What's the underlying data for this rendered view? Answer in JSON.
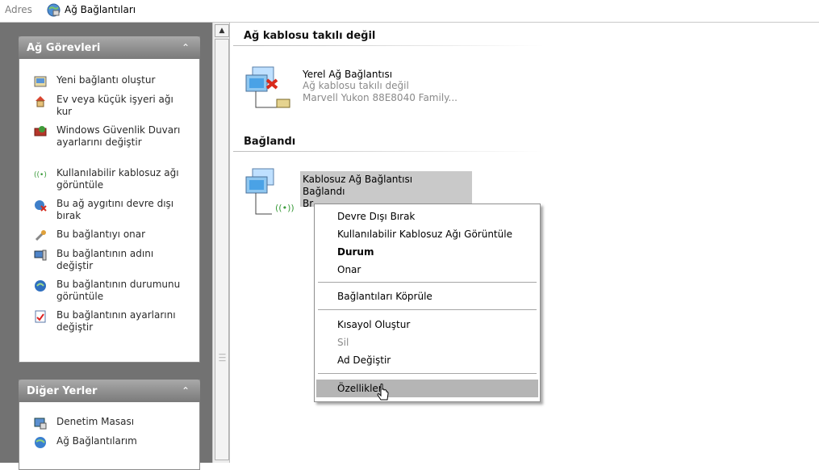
{
  "address": {
    "label": "Adres",
    "value": "Ağ Bağlantıları"
  },
  "tasks_panel": {
    "title": "Ağ Görevleri",
    "items": [
      {
        "icon": "new-connection-icon",
        "label": "Yeni bağlantı oluştur"
      },
      {
        "icon": "home-network-icon",
        "label": "Ev veya küçük işyeri ağı kur"
      },
      {
        "icon": "firewall-icon",
        "label": "Windows Güvenlik Duvarı ayarlarını değiştir"
      },
      {
        "icon": "wireless-icon",
        "label": "Kullanılabilir kablosuz ağı görüntüle"
      },
      {
        "icon": "disable-device-icon",
        "label": "Bu ağ aygıtını devre dışı bırak"
      },
      {
        "icon": "repair-icon",
        "label": "Bu bağlantıyı onar"
      },
      {
        "icon": "rename-icon",
        "label": "Bu bağlantının adını değiştir"
      },
      {
        "icon": "status-icon",
        "label": "Bu bağlantının durumunu görüntüle"
      },
      {
        "icon": "settings-icon",
        "label": "Bu bağlantının ayarlarını değiştir"
      }
    ]
  },
  "other_places_panel": {
    "title": "Diğer Yerler",
    "items": [
      {
        "icon": "control-panel-icon",
        "label": "Denetim Masası"
      },
      {
        "icon": "my-network-icon",
        "label": "Ağ Bağlantılarım"
      }
    ]
  },
  "groups": [
    {
      "title": "Ağ kablosu takılı değil",
      "connection": {
        "name": "Yerel Ağ Bağlantısı",
        "status": "Ağ kablosu takılı değil",
        "device": "Marvell Yukon 88E8040 Family..."
      }
    },
    {
      "title": "Bağlandı",
      "connection": {
        "name": "Kablosuz Ağ Bağlantısı",
        "status": "Bağlandı",
        "device": "Br"
      }
    }
  ],
  "context_menu": {
    "items": [
      "Devre Dışı Bırak",
      "Kullanılabilir Kablosuz Ağı Görüntüle",
      "Durum",
      "Onar",
      "Bağlantıları Köprüle",
      "Kısayol Oluştur",
      "Sil",
      "Ad Değiştir",
      "Özellikler"
    ],
    "default_item": "Durum",
    "highlighted_item": "Özellikler"
  },
  "colors": {
    "pane_background": "#727272",
    "menu_highlight": "#b5b5b5",
    "grey_text": "#8a8a8a"
  }
}
